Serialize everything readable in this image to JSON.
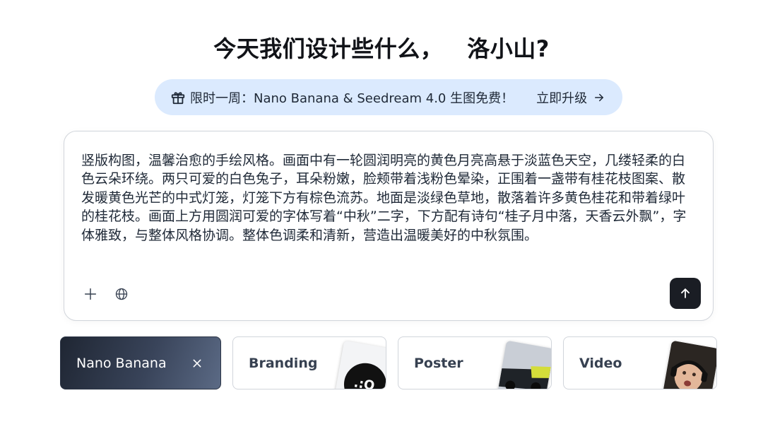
{
  "header": {
    "greeting": "今天我们设计些什么，",
    "user_name": "洛小山?"
  },
  "promo": {
    "icon": "gift-icon",
    "text": "限时一周：Nano Banana & Seedream 4.0 生图免费！",
    "upgrade_label": "立即升级",
    "upgrade_icon": "arrow-right-icon",
    "background_color": "#dbeafe"
  },
  "composer": {
    "prompt_text": "竖版构图，温馨治愈的手绘风格。画面中有一轮圆润明亮的黄色月亮高悬于淡蓝色天空，几缕轻柔的白色云朵环绕。两只可爱的白色兔子，耳朵粉嫩，脸颊带着浅粉色晕染，正围着一盏带有桂花枝图案、散发暖黄色光芒的中式灯笼，灯笼下方有棕色流苏。地面是淡绿色草地，散落着许多黄色桂花和带着绿叶的桂花枝。画面上方用圆润可爱的字体写着“中秋”二字，下方配有诗句“桂子月中落，天香云外飘”，字体雅致，与整体风格协调。整体色调柔和清新，营造出温暖美好的中秋氛围。",
    "tools": [
      {
        "name": "add",
        "icon": "plus-icon"
      },
      {
        "name": "web",
        "icon": "globe-icon"
      }
    ],
    "send_icon": "arrow-up-icon"
  },
  "chips": [
    {
      "label": "Nano Banana",
      "active": true,
      "icon": "close-icon"
    },
    {
      "label": "Branding",
      "active": false
    },
    {
      "label": "Poster",
      "active": false
    },
    {
      "label": "Video",
      "active": false
    }
  ]
}
